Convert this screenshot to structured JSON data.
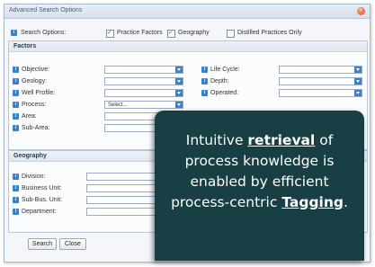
{
  "window": {
    "title": "Advanced Search Options"
  },
  "search_options": {
    "label": "Search Options:",
    "checks": [
      {
        "label": "Practice Factors",
        "checked": true
      },
      {
        "label": "Geography",
        "checked": true
      },
      {
        "label": "Distilled Practices Only",
        "checked": false
      }
    ]
  },
  "factors": {
    "title": "Factors",
    "left": [
      {
        "label": "Objective:",
        "value": ""
      },
      {
        "label": "Geology:",
        "value": ""
      },
      {
        "label": "Well Profile:",
        "value": ""
      },
      {
        "label": "Process:",
        "value": "Select..."
      },
      {
        "label": "Area:",
        "value": ""
      },
      {
        "label": "Sub-Area:",
        "value": ""
      }
    ],
    "right": [
      {
        "label": "Life Cycle:",
        "value": ""
      },
      {
        "label": "Depth:",
        "value": ""
      },
      {
        "label": "Operated:",
        "value": ""
      }
    ]
  },
  "geography": {
    "title": "Geography",
    "fields": [
      {
        "label": "Division:"
      },
      {
        "label": "Business Unit:"
      },
      {
        "label": "Sub-Bus. Unit:"
      },
      {
        "label": "Department:"
      }
    ]
  },
  "buttons": {
    "search": "Search",
    "close": "Close"
  },
  "callout": {
    "part1": "Intuitive ",
    "bold1": "retrieval",
    "part2": " of process knowledge is enabled by efficient process-centric ",
    "bold2": "Tagging",
    "part3": "."
  },
  "colors": {
    "accent": "#3f7fc4",
    "callout_bg": "#183f44"
  },
  "icons": {
    "field_icon": "info-icon",
    "close": "close-icon"
  }
}
